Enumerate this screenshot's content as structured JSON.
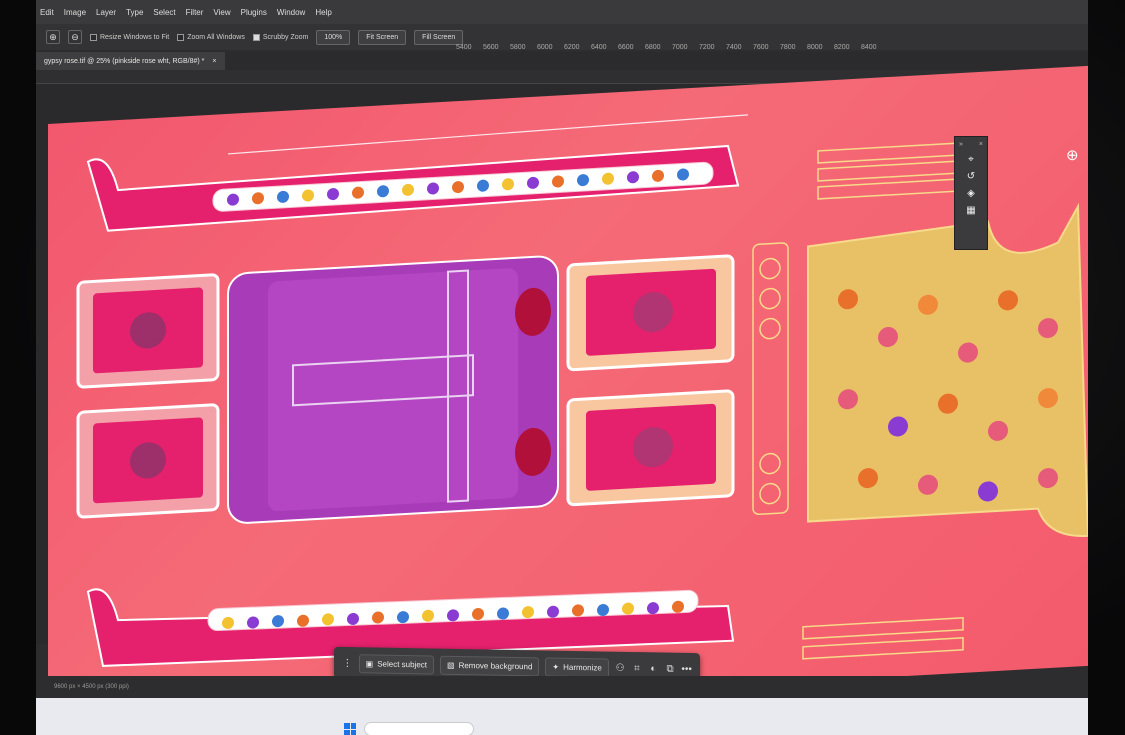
{
  "menu": {
    "items": [
      "Edit",
      "Image",
      "Layer",
      "Type",
      "Select",
      "Filter",
      "View",
      "Plugins",
      "Window",
      "Help"
    ]
  },
  "options": {
    "resize_windows": "Resize Windows to Fit",
    "zoom_all": "Zoom All Windows",
    "scrubby_zoom": "Scrubby Zoom",
    "zoom_value": "100%",
    "fit_screen": "Fit Screen",
    "fill_screen": "Fill Screen"
  },
  "ruler_labels": [
    "5400",
    "5600",
    "5800",
    "6000",
    "6200",
    "6400",
    "6600",
    "6800",
    "7000",
    "7200",
    "7400",
    "7600",
    "7800",
    "8000",
    "8200",
    "8400"
  ],
  "document_tab": {
    "title": "gypsy rose.tif @ 25% (pinkside rose wht, RGB/8#) *",
    "close": "×"
  },
  "context_bar": {
    "select_subject": "Select subject",
    "remove_background": "Remove background",
    "harmonize": "Harmonize",
    "more": "•••"
  },
  "status": {
    "doc_info": "9600 px × 4500 px (300 ppi)"
  },
  "colors": {
    "artboard": "#f2576e",
    "tufted": "#a83bb8",
    "floral_panel": "#e8c167",
    "accent_pink": "#e5206c"
  }
}
